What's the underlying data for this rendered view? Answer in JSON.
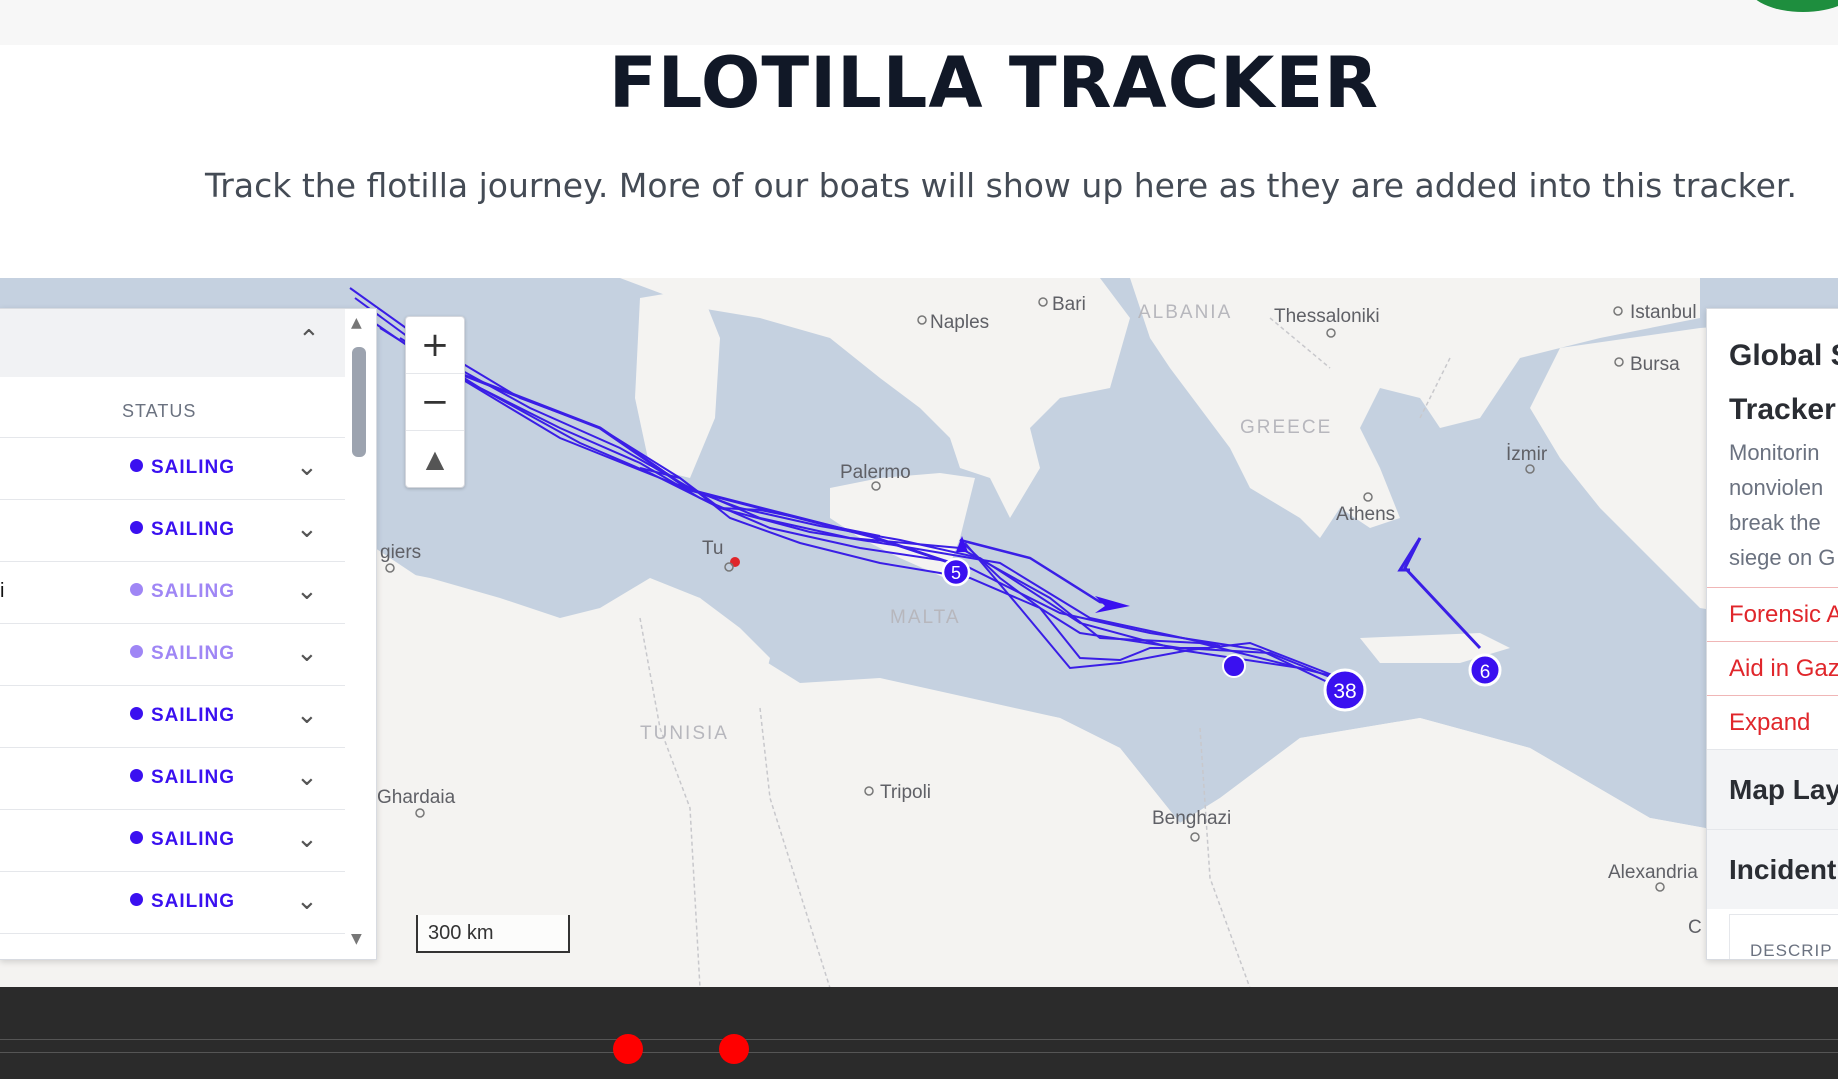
{
  "header": {
    "title": "FLOTILLA TRACKER",
    "subtitle": "Track the flotilla journey. More of our boats will show up here as they are added into this tracker."
  },
  "map": {
    "places": {
      "naples": "Naples",
      "bari": "Bari",
      "thessaloniki": "Thessaloniki",
      "istanbul": "Istanbul",
      "bursa": "Bursa",
      "izmir": "İzmir",
      "palermo": "Palermo",
      "athens": "Athens",
      "algiers": "giers",
      "tunis": "Tu",
      "tripoli": "Tripoli",
      "benghazi": "Benghazi",
      "ghardaia": "Ghardaia",
      "alexandria": "Alexandria",
      "cairo_partial": "C"
    },
    "countries": {
      "albania": "ALBANIA",
      "greece": "GREECE",
      "malta": "MALTA",
      "tunisia": "TUNISIA"
    },
    "clusters": {
      "c5": "5",
      "c38": "38",
      "c6": "6"
    },
    "zoom_in": "+",
    "zoom_out": "−",
    "compass": "▲",
    "scale": "300 km",
    "colors": {
      "sea": "#c5d1e0",
      "land": "#f4f3f1",
      "track": "#3a1ee6",
      "alert": "#e0262b"
    }
  },
  "vessel_panel": {
    "status_header": "STATUS",
    "rows": [
      {
        "name": "",
        "status": "SAILING",
        "color": "#3a10f0"
      },
      {
        "name": "",
        "status": "SAILING",
        "color": "#3a10f0"
      },
      {
        "name": "i",
        "status": "SAILING",
        "color": "#9f86f5"
      },
      {
        "name": "",
        "status": "SAILING",
        "color": "#9f86f5"
      },
      {
        "name": "",
        "status": "SAILING",
        "color": "#3a10f0"
      },
      {
        "name": "",
        "status": "SAILING",
        "color": "#3a10f0"
      },
      {
        "name": "",
        "status": "SAILING",
        "color": "#3a10f0"
      },
      {
        "name": "",
        "status": "SAILING",
        "color": "#3a10f0"
      }
    ]
  },
  "info_panel": {
    "title_line1": "Global S",
    "title_line2": "Tracker",
    "desc_lines": [
      "Monitorin",
      "nonviolen",
      "break the",
      "siege on G"
    ],
    "links": [
      "Forensic A",
      "Aid in Gaz",
      "Expand"
    ],
    "sections": [
      "Map Lay",
      "Incident"
    ],
    "table_header": "DESCRIP"
  }
}
